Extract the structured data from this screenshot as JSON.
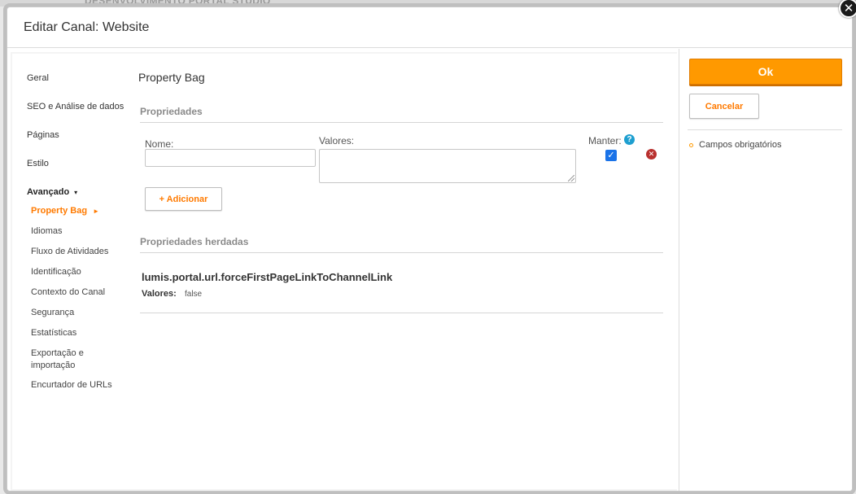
{
  "background": {
    "top_text": "DESENVOLVIMENTO PORTAL STUDIO"
  },
  "modal": {
    "title": "Editar Canal: Website",
    "close_symbol": "✕"
  },
  "sidebar": {
    "items": [
      {
        "label": "Geral"
      },
      {
        "label": "SEO e Análise de dados"
      },
      {
        "label": "Páginas"
      },
      {
        "label": "Estilo"
      }
    ],
    "group": {
      "label": "Avançado",
      "caret": "▾"
    },
    "sub_items": [
      {
        "label": "Property Bag",
        "active": true,
        "arrow": "►"
      },
      {
        "label": "Idiomas"
      },
      {
        "label": "Fluxo de Atividades"
      },
      {
        "label": "Identificação"
      },
      {
        "label": "Contexto do Canal"
      },
      {
        "label": "Segurança"
      },
      {
        "label": "Estatísticas"
      },
      {
        "label": "Exportação e importação"
      },
      {
        "label": "Encurtador de URLs"
      }
    ]
  },
  "main": {
    "section_title": "Property Bag",
    "properties": {
      "heading": "Propriedades",
      "name_label": "Nome:",
      "name_value": "",
      "values_label": "Valores:",
      "values_value": "",
      "keep_label": "Manter:",
      "keep_checked": true,
      "add_button": "+ Adicionar"
    },
    "inherited": {
      "heading": "Propriedades herdadas",
      "items": [
        {
          "name": "lumis.portal.url.forceFirstPageLinkToChannelLink",
          "values_label": "Valores:",
          "values": "false"
        }
      ]
    }
  },
  "actions": {
    "ok_label": "Ok",
    "cancel_label": "Cancelar",
    "required_note": "Campos obrigatórios"
  },
  "colors": {
    "accent": "#ff9900",
    "accent_text": "#ff7a00",
    "checkbox": "#1a73e8",
    "help": "#1e9fd0",
    "remove": "#b9312f"
  }
}
